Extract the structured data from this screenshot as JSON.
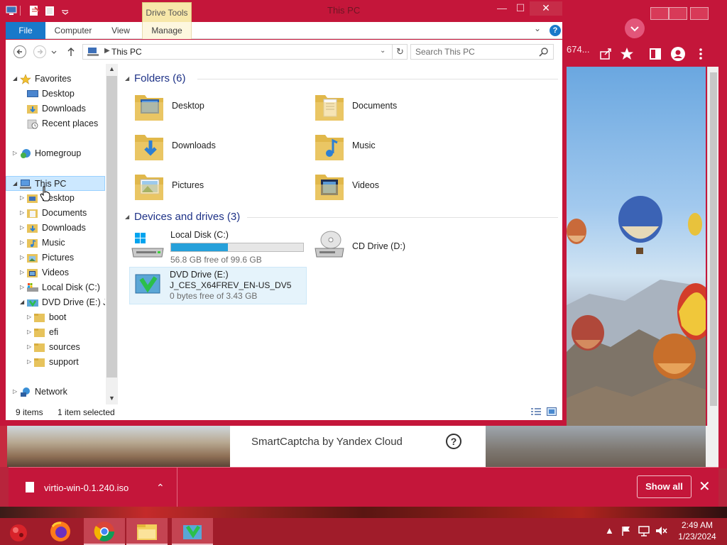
{
  "explorer": {
    "window_title": "This PC",
    "context_tab": "Drive Tools",
    "ribbon_tabs": {
      "file": "File",
      "computer": "Computer",
      "view": "View",
      "manage": "Manage"
    },
    "address": {
      "path": "This PC"
    },
    "search": {
      "placeholder": "Search This PC"
    },
    "nav": {
      "favorites": "Favorites",
      "desktop": "Desktop",
      "downloads": "Downloads",
      "recent_places": "Recent places",
      "homegroup": "Homegroup",
      "this_pc": "This PC",
      "pc_desktop": "Desktop",
      "pc_documents": "Documents",
      "pc_downloads": "Downloads",
      "pc_music": "Music",
      "pc_pictures": "Pictures",
      "pc_videos": "Videos",
      "local_disk": "Local Disk (C:)",
      "dvd_drive": "DVD Drive (E:) J_C",
      "boot": "boot",
      "efi": "efi",
      "sources": "sources",
      "support": "support",
      "network": "Network"
    },
    "folders_header": "Folders (6)",
    "folders": [
      {
        "name": "Desktop"
      },
      {
        "name": "Documents"
      },
      {
        "name": "Downloads"
      },
      {
        "name": "Music"
      },
      {
        "name": "Pictures"
      },
      {
        "name": "Videos"
      }
    ],
    "devices_header": "Devices and drives (3)",
    "drives": {
      "c": {
        "name": "Local Disk (C:)",
        "free": "56.8 GB free of 99.6 GB",
        "used_fraction": 0.43
      },
      "d": {
        "name": "CD Drive (D:)"
      },
      "e": {
        "name": "DVD Drive (E:)",
        "label": "J_CES_X64FREV_EN-US_DV5",
        "free": "0 bytes free of 3.43 GB"
      }
    },
    "status": {
      "items": "9 items",
      "selected": "1 item selected"
    }
  },
  "browser": {
    "url_fragment": "674..."
  },
  "captcha": {
    "label": "SmartCaptcha by Yandex Cloud",
    "help": "?"
  },
  "downloads_bar": {
    "filename": "virtio-win-0.1.240.iso",
    "show_all": "Show all"
  },
  "taskbar": {
    "time": "2:49 AM",
    "date": "1/23/2024"
  },
  "colors": {
    "window_frame": "#c4163a",
    "accent_blue": "#1979ca",
    "selection": "#cce8ff",
    "group_header": "#1e3287",
    "drive_bar": "#26a0da"
  }
}
